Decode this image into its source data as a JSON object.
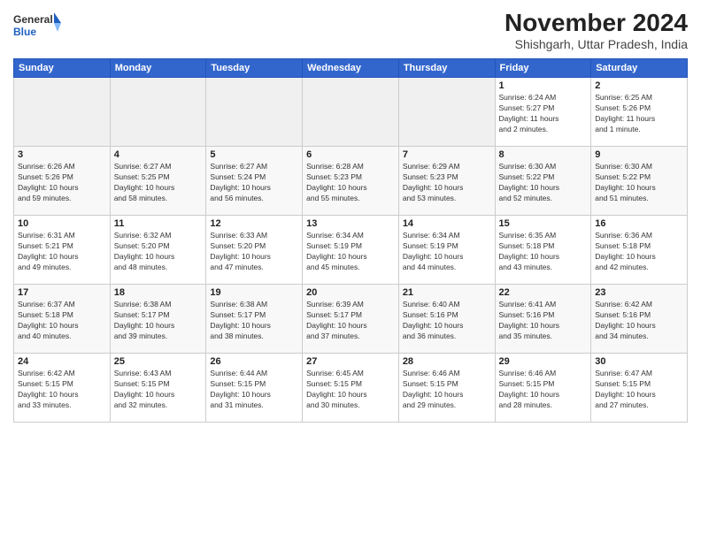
{
  "header": {
    "logo_line1": "General",
    "logo_line2": "Blue",
    "month_title": "November 2024",
    "location": "Shishgarh, Uttar Pradesh, India"
  },
  "weekdays": [
    "Sunday",
    "Monday",
    "Tuesday",
    "Wednesday",
    "Thursday",
    "Friday",
    "Saturday"
  ],
  "weeks": [
    [
      {
        "day": "",
        "info": ""
      },
      {
        "day": "",
        "info": ""
      },
      {
        "day": "",
        "info": ""
      },
      {
        "day": "",
        "info": ""
      },
      {
        "day": "",
        "info": ""
      },
      {
        "day": "1",
        "info": "Sunrise: 6:24 AM\nSunset: 5:27 PM\nDaylight: 11 hours\nand 2 minutes."
      },
      {
        "day": "2",
        "info": "Sunrise: 6:25 AM\nSunset: 5:26 PM\nDaylight: 11 hours\nand 1 minute."
      }
    ],
    [
      {
        "day": "3",
        "info": "Sunrise: 6:26 AM\nSunset: 5:26 PM\nDaylight: 10 hours\nand 59 minutes."
      },
      {
        "day": "4",
        "info": "Sunrise: 6:27 AM\nSunset: 5:25 PM\nDaylight: 10 hours\nand 58 minutes."
      },
      {
        "day": "5",
        "info": "Sunrise: 6:27 AM\nSunset: 5:24 PM\nDaylight: 10 hours\nand 56 minutes."
      },
      {
        "day": "6",
        "info": "Sunrise: 6:28 AM\nSunset: 5:23 PM\nDaylight: 10 hours\nand 55 minutes."
      },
      {
        "day": "7",
        "info": "Sunrise: 6:29 AM\nSunset: 5:23 PM\nDaylight: 10 hours\nand 53 minutes."
      },
      {
        "day": "8",
        "info": "Sunrise: 6:30 AM\nSunset: 5:22 PM\nDaylight: 10 hours\nand 52 minutes."
      },
      {
        "day": "9",
        "info": "Sunrise: 6:30 AM\nSunset: 5:22 PM\nDaylight: 10 hours\nand 51 minutes."
      }
    ],
    [
      {
        "day": "10",
        "info": "Sunrise: 6:31 AM\nSunset: 5:21 PM\nDaylight: 10 hours\nand 49 minutes."
      },
      {
        "day": "11",
        "info": "Sunrise: 6:32 AM\nSunset: 5:20 PM\nDaylight: 10 hours\nand 48 minutes."
      },
      {
        "day": "12",
        "info": "Sunrise: 6:33 AM\nSunset: 5:20 PM\nDaylight: 10 hours\nand 47 minutes."
      },
      {
        "day": "13",
        "info": "Sunrise: 6:34 AM\nSunset: 5:19 PM\nDaylight: 10 hours\nand 45 minutes."
      },
      {
        "day": "14",
        "info": "Sunrise: 6:34 AM\nSunset: 5:19 PM\nDaylight: 10 hours\nand 44 minutes."
      },
      {
        "day": "15",
        "info": "Sunrise: 6:35 AM\nSunset: 5:18 PM\nDaylight: 10 hours\nand 43 minutes."
      },
      {
        "day": "16",
        "info": "Sunrise: 6:36 AM\nSunset: 5:18 PM\nDaylight: 10 hours\nand 42 minutes."
      }
    ],
    [
      {
        "day": "17",
        "info": "Sunrise: 6:37 AM\nSunset: 5:18 PM\nDaylight: 10 hours\nand 40 minutes."
      },
      {
        "day": "18",
        "info": "Sunrise: 6:38 AM\nSunset: 5:17 PM\nDaylight: 10 hours\nand 39 minutes."
      },
      {
        "day": "19",
        "info": "Sunrise: 6:38 AM\nSunset: 5:17 PM\nDaylight: 10 hours\nand 38 minutes."
      },
      {
        "day": "20",
        "info": "Sunrise: 6:39 AM\nSunset: 5:17 PM\nDaylight: 10 hours\nand 37 minutes."
      },
      {
        "day": "21",
        "info": "Sunrise: 6:40 AM\nSunset: 5:16 PM\nDaylight: 10 hours\nand 36 minutes."
      },
      {
        "day": "22",
        "info": "Sunrise: 6:41 AM\nSunset: 5:16 PM\nDaylight: 10 hours\nand 35 minutes."
      },
      {
        "day": "23",
        "info": "Sunrise: 6:42 AM\nSunset: 5:16 PM\nDaylight: 10 hours\nand 34 minutes."
      }
    ],
    [
      {
        "day": "24",
        "info": "Sunrise: 6:42 AM\nSunset: 5:15 PM\nDaylight: 10 hours\nand 33 minutes."
      },
      {
        "day": "25",
        "info": "Sunrise: 6:43 AM\nSunset: 5:15 PM\nDaylight: 10 hours\nand 32 minutes."
      },
      {
        "day": "26",
        "info": "Sunrise: 6:44 AM\nSunset: 5:15 PM\nDaylight: 10 hours\nand 31 minutes."
      },
      {
        "day": "27",
        "info": "Sunrise: 6:45 AM\nSunset: 5:15 PM\nDaylight: 10 hours\nand 30 minutes."
      },
      {
        "day": "28",
        "info": "Sunrise: 6:46 AM\nSunset: 5:15 PM\nDaylight: 10 hours\nand 29 minutes."
      },
      {
        "day": "29",
        "info": "Sunrise: 6:46 AM\nSunset: 5:15 PM\nDaylight: 10 hours\nand 28 minutes."
      },
      {
        "day": "30",
        "info": "Sunrise: 6:47 AM\nSunset: 5:15 PM\nDaylight: 10 hours\nand 27 minutes."
      }
    ]
  ]
}
